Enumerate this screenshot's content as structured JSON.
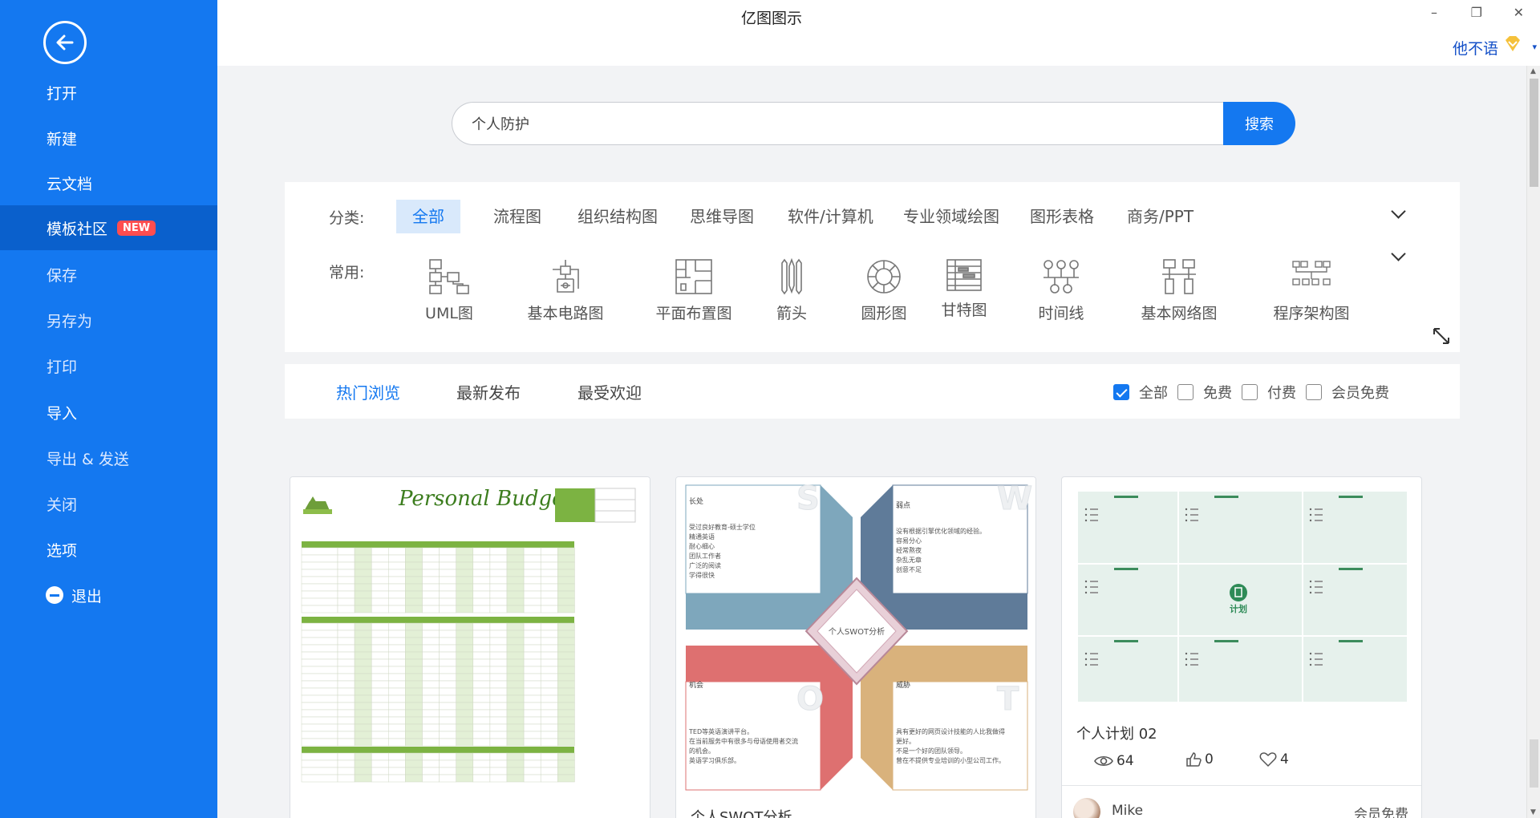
{
  "app": {
    "title": "亿图图示"
  },
  "window": {
    "minimize_glyph": "–",
    "restore_glyph": "❐",
    "close_glyph": "✕"
  },
  "user": {
    "name": "他不语",
    "vip_icon": "vip-diamond-icon",
    "caret": "▾"
  },
  "sidebar": {
    "back_icon": "back-arrow-icon",
    "items": [
      {
        "label": "打开"
      },
      {
        "label": "新建"
      },
      {
        "label": "云文档"
      },
      {
        "label": "模板社区",
        "badge": "NEW",
        "active": true
      },
      {
        "label": "保存"
      },
      {
        "label": "另存为"
      },
      {
        "label": "打印"
      },
      {
        "label": "导入"
      },
      {
        "label": "导出 & 发送"
      },
      {
        "label": "关闭"
      },
      {
        "label": "选项"
      },
      {
        "label": "退出"
      }
    ]
  },
  "search": {
    "value": "个人防护",
    "button_label": "搜索"
  },
  "categories": {
    "label": "分类:",
    "items": [
      "全部",
      "流程图",
      "组织结构图",
      "思维导图",
      "软件/计算机",
      "专业领域绘图",
      "图形表格",
      "商务/PPT"
    ],
    "active_index": 0
  },
  "common": {
    "label": "常用:",
    "items": [
      {
        "label": "UML图",
        "icon": "uml-icon"
      },
      {
        "label": "基本电路图",
        "icon": "circuit-icon"
      },
      {
        "label": "平面布置图",
        "icon": "floor-plan-icon"
      },
      {
        "label": "箭头",
        "icon": "arrows-icon"
      },
      {
        "label": "圆形图",
        "icon": "circular-icon"
      },
      {
        "label": "甘特图",
        "icon": "gantt-icon"
      },
      {
        "label": "时间线",
        "icon": "timeline-icon"
      },
      {
        "label": "基本网络图",
        "icon": "network-icon"
      },
      {
        "label": "程序架构图",
        "icon": "architecture-icon"
      }
    ]
  },
  "tabs": {
    "items": [
      "热门浏览",
      "最新发布",
      "最受欢迎"
    ],
    "active_index": 0
  },
  "filters": [
    {
      "label": "全部",
      "checked": true
    },
    {
      "label": "免费",
      "checked": false
    },
    {
      "label": "付费",
      "checked": false
    },
    {
      "label": "会员免费",
      "checked": false
    }
  ],
  "cards": [
    {
      "title": "",
      "preview_title": "Personal Budget"
    },
    {
      "title": "个人SWOT分析",
      "swot": {
        "center": "个人SWOT分析",
        "letters": [
          "S",
          "W",
          "O",
          "T"
        ],
        "headings": [
          "长处",
          "弱点",
          "机会",
          "威胁"
        ],
        "texts": [
          [
            "受过良好教育-硕士学位",
            "精通英语",
            "耐心细心",
            "团队工作者",
            "广泛的阅读",
            "学得很快"
          ],
          [
            "没有根据引擎优化领域的经验。",
            "容易分心",
            "经常熬夜",
            "杂乱无章",
            "创意不足"
          ],
          [
            "TED等英语演讲平台。",
            "在当前服务中有很多与母语使用者交流",
            "的机会。",
            "英语学习俱乐部。"
          ],
          [
            "具有更好的网页设计技能的人比我做得",
            "更好。",
            "不是一个好的团队领导。",
            "曾在不提供专业培训的小型公司工作。"
          ]
        ]
      }
    },
    {
      "title": "个人计划 02",
      "views": "64",
      "likes": "0",
      "favorites": "4",
      "author": "Mike",
      "price": "会员免费",
      "plan_center": "计划"
    }
  ]
}
